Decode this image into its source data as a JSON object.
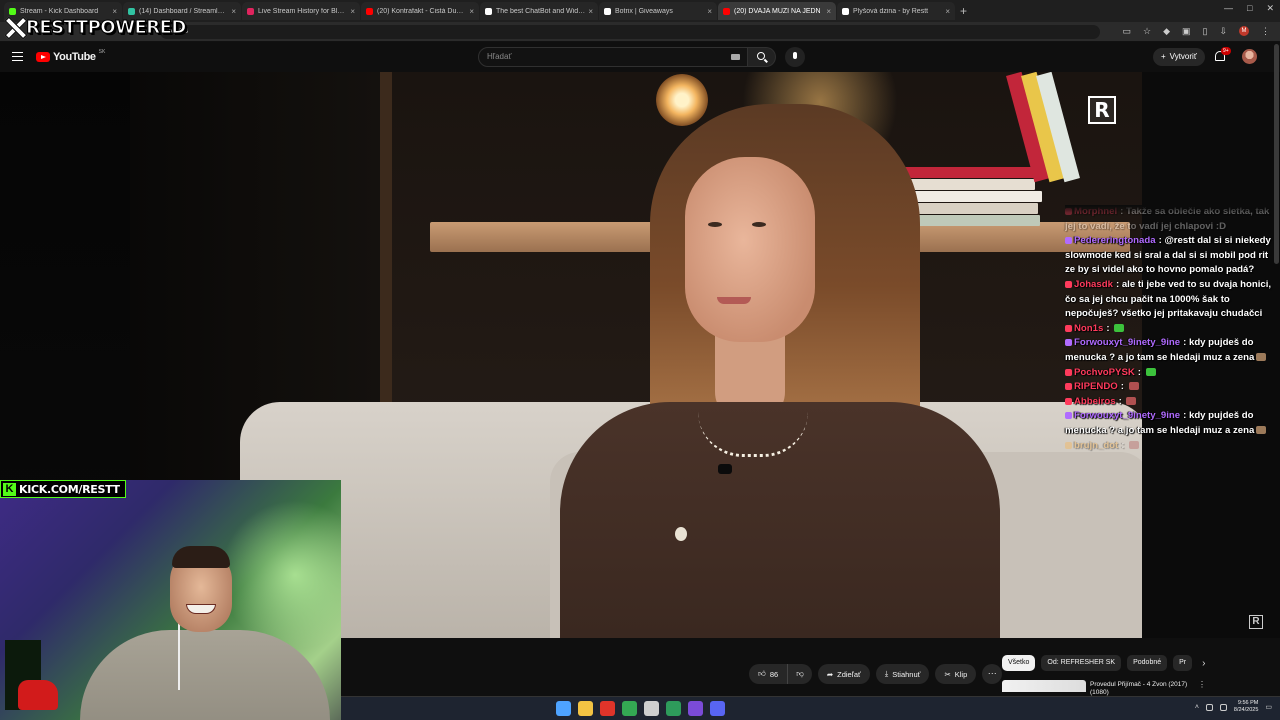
{
  "browser": {
    "tabs": [
      {
        "label": "Stream - Kick Dashboard",
        "color": "#53fc18",
        "active": false
      },
      {
        "label": "(14) Dashboard / Streamlabs",
        "color": "#31c3a2",
        "active": false
      },
      {
        "label": "Live Stream History for Blerp S",
        "color": "#e0245e",
        "active": false
      },
      {
        "label": "(20) Kontrafakt - Čistá Duša pr",
        "color": "#ff0000",
        "active": false
      },
      {
        "label": "The best ChatBot and Widgets",
        "color": "#ffffff",
        "active": false
      },
      {
        "label": "Botrix | Giveaways",
        "color": "#ffffff",
        "active": false
      },
      {
        "label": "(20) DVAJA MUŽI NA JEDN",
        "color": "#ff0000",
        "active": true
      },
      {
        "label": "Plyšová dzina - by Restt",
        "color": "#ffffff",
        "active": false
      }
    ],
    "tab_close": "×",
    "new_tab": "+",
    "window_controls": [
      "—",
      "□",
      "✕"
    ],
    "url_fragment": "A-bSB",
    "profile_letter": "M"
  },
  "overlay": {
    "brand": "RESTTPOWERED",
    "kick_handle": "KICK.COM/RESTT"
  },
  "youtube": {
    "logo_text": "YouTube",
    "country": "SK",
    "search_placeholder": "Hľadať",
    "create_label": "Vytvoriť",
    "create_plus": "+",
    "notif_count": "9+",
    "channel_mark": "R"
  },
  "chat": {
    "messages": [
      {
        "user": "Morphnel",
        "user_color": "#ff4060",
        "text": "Takže sa oblečie ako sletka, tak jej to vadí, že to vadí jej chlapovi :D",
        "fade": true
      },
      {
        "user": "Pedereringtonada",
        "user_color": "#b06bff",
        "text": "@restt dal si si niekedy slowmode ked si sral a dal si si mobil pod rit ze by si videl ako to hovno pomalo padá?",
        "fade": false
      },
      {
        "user": "Johasdk",
        "user_color": "#ff3b5c",
        "text": "ale ti jebe ved to su dvaja honici, čo sa jej chcu pačit na 1000% šak to nepočuješ? všetko jej pritakavaju chudačci",
        "fade": false
      },
      {
        "user": "Non1s",
        "user_color": "#ff3b5c",
        "text": "",
        "emote": "#3cc23c",
        "fade": false
      },
      {
        "user": "Forwouxyt_9inety_9ine",
        "user_color": "#b06bff",
        "text": "kdy pujdeš do menucka ? a jo tam se hledaji muz a zena",
        "emote": "#9c7a5a",
        "fade": false
      },
      {
        "user": "PochvoPYSK",
        "user_color": "#ff3b5c",
        "text": "",
        "emote": "#3cc23c",
        "fade": false
      },
      {
        "user": "RIPENDO",
        "user_color": "#ff3b5c",
        "text": "",
        "emote": "#b05050",
        "fade": false
      },
      {
        "user": "Abbeiros",
        "user_color": "#ff3b5c",
        "text": "",
        "emote": "#b05050",
        "fade": false
      },
      {
        "user": "Forwouxyt_9inety_9ine",
        "user_color": "#b06bff",
        "text": "kdy pujdeš do menucka ? a jo tam se hledaji muz a zena",
        "emote": "#9c7a5a",
        "fade": false
      },
      {
        "user": "brujn_dot",
        "user_color": "#ffb040",
        "text": "",
        "emote": "#b05050",
        "fade": true
      }
    ]
  },
  "actions": {
    "like_count": "86",
    "share_label": "Zdieľať",
    "download_label": "Stiahnuť",
    "clip_label": "Klip",
    "more": "···"
  },
  "chips": [
    "Všetko",
    "Od: REFRESHER SK",
    "Podobné",
    "Pr"
  ],
  "chip_next": "›",
  "recommendation": {
    "title": "Provedul Přijímač - 4 Zvon (2017) (1080)",
    "more": "⋮"
  },
  "taskbar": {
    "time": "9:56 PM",
    "date": "8/24/2025",
    "icon_colors": [
      "#4ea3ff",
      "#f3c343",
      "#e0342a",
      "#34a853",
      "#cfcfcf",
      "#2e9b5b",
      "#7b4bd8",
      "#5865f2"
    ]
  }
}
